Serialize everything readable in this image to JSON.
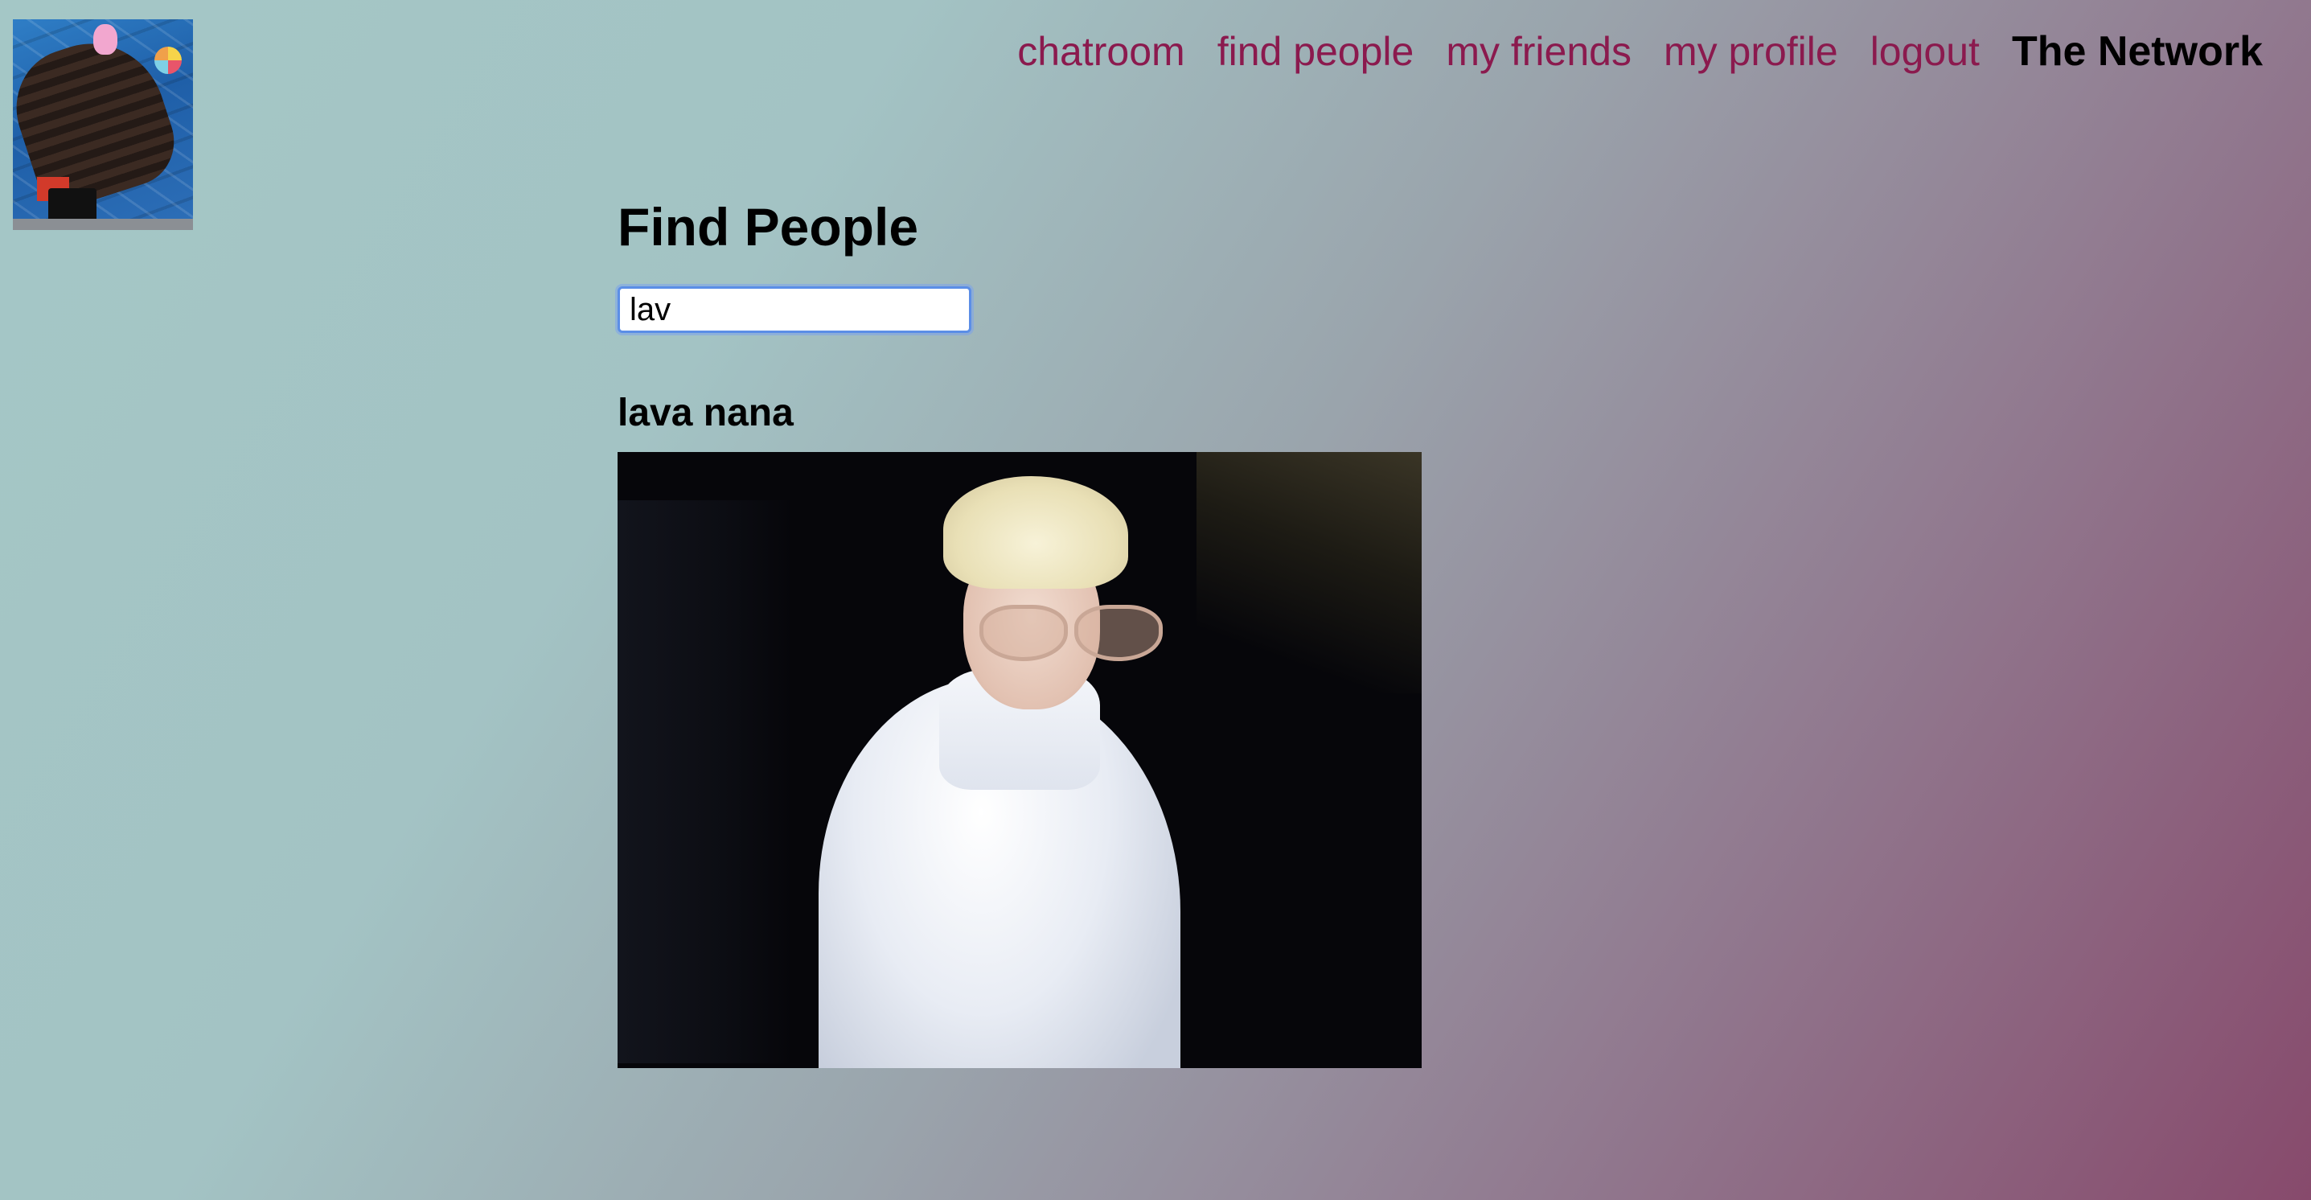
{
  "header": {
    "avatar_name": "user-avatar"
  },
  "nav": {
    "items": [
      {
        "label": "chatroom"
      },
      {
        "label": "find people"
      },
      {
        "label": "my friends"
      },
      {
        "label": "my profile"
      },
      {
        "label": "logout"
      }
    ],
    "brand": "The Network"
  },
  "main": {
    "title": "Find People",
    "search": {
      "value": "lav",
      "placeholder": ""
    },
    "results": [
      {
        "name": "lava nana"
      }
    ]
  },
  "colors": {
    "nav_link": "#8b1a4e",
    "brand": "#000000",
    "focus_ring": "#5b8ee6"
  }
}
